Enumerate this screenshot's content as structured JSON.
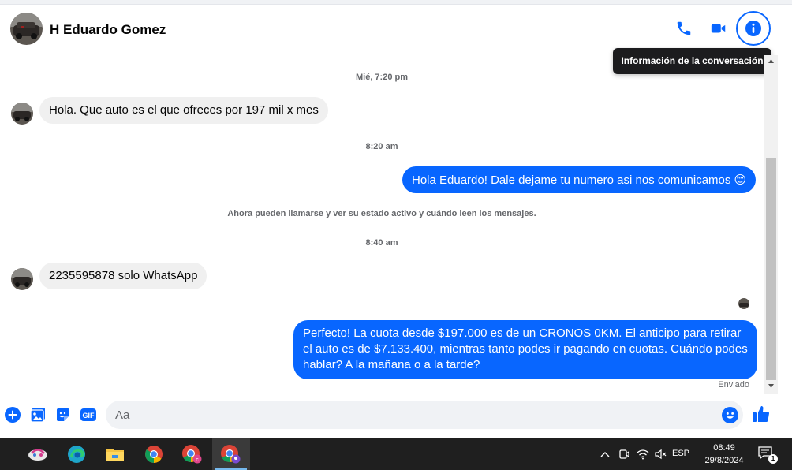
{
  "header": {
    "contact_name": "H Eduardo Gomez",
    "call_icon": "phone-icon",
    "video_icon": "video-camera-icon",
    "info_icon": "info-icon",
    "tooltip": "Información de la conversación",
    "accent_color": "#0866ff"
  },
  "messages": {
    "timestamp_1": "Mié, 7:20 pm",
    "msg_1": "Hola. Que auto es el que ofreces por 197 mil x mes",
    "timestamp_2": "8:20 am",
    "msg_2": "Hola Eduardo! Dale dejame tu numero  asi nos comunicamos 😊",
    "system_notice": "Ahora pueden llamarse y ver su estado activo y cuándo leen los mensajes.",
    "timestamp_3": "8:40 am",
    "msg_3": "2235595878 solo WhatsApp",
    "msg_4": "Perfecto! La cuota desde $197.000 es de un CRONOS 0KM. El anticipo para retirar el auto es de $7.133.400, mientras tanto podes ir pagando en cuotas. Cuándo podes hablar? A la mañana o a la tarde?",
    "status": "Enviado",
    "outgoing_color": "#0866ff",
    "incoming_color": "#f0f0f0"
  },
  "composer": {
    "placeholder": "Aa",
    "icons": [
      "plus-icon",
      "photo-icon",
      "sticker-icon",
      "gif-icon",
      "emoji-icon",
      "like-icon"
    ],
    "gif_label": "GIF"
  },
  "taskbar": {
    "apps": [
      "app-icon",
      "edge-icon",
      "file-explorer-icon",
      "chrome-icon",
      "chrome-profile-c-icon",
      "chrome-profile-active-icon"
    ],
    "language": "ESP",
    "time": "08:49",
    "date": "29/8/2024",
    "notification_count": "1"
  }
}
